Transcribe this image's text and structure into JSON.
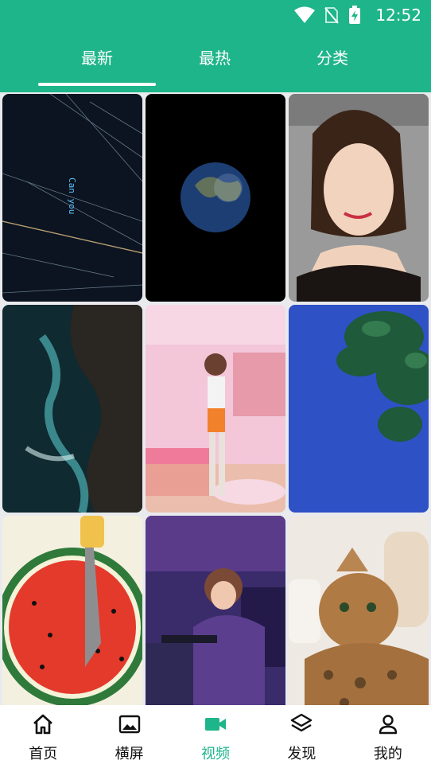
{
  "status_bar": {
    "time": "12:52"
  },
  "tabs": [
    {
      "label": "最新",
      "active": true
    },
    {
      "label": "最热",
      "active": false
    },
    {
      "label": "分类",
      "active": false
    }
  ],
  "tiles": [
    {
      "caption": "Can you"
    }
  ],
  "bottom_nav": [
    {
      "label": "首页",
      "icon": "home-icon",
      "active": false
    },
    {
      "label": "横屏",
      "icon": "image-icon",
      "active": false
    },
    {
      "label": "视频",
      "icon": "video-camera-icon",
      "active": true
    },
    {
      "label": "发现",
      "icon": "layers-icon",
      "active": false
    },
    {
      "label": "我的",
      "icon": "user-icon",
      "active": false
    }
  ],
  "colors": {
    "primary": "#1fb58a",
    "nav_text": "#111111",
    "background": "#e9eaee"
  }
}
